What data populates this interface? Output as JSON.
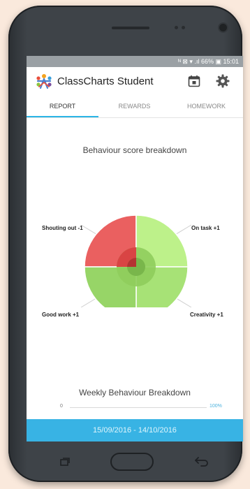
{
  "status_bar": {
    "text": "ᴺ ⊠ ▾ .ıl 66% ▣ 15:01"
  },
  "app": {
    "title": "ClassCharts Student"
  },
  "tabs": [
    {
      "label": "REPORT",
      "active": true
    },
    {
      "label": "REWARDS",
      "active": false
    },
    {
      "label": "HOMEWORK",
      "active": false
    }
  ],
  "report": {
    "breakdown_title": "Behaviour score breakdown",
    "weekly_title": "Weekly Behaviour Breakdown",
    "progress_min": "0",
    "progress_max": "100%",
    "date_range": "15/09/2016 - 14/10/2016"
  },
  "chart_data": {
    "type": "pie",
    "slices": [
      {
        "label": "Shouting out -1",
        "value": 1,
        "color": "#ea6060"
      },
      {
        "label": "On task +1",
        "value": 1,
        "color": "#bdf18a"
      },
      {
        "label": "Creativity +1",
        "value": 1,
        "color": "#a7e276"
      },
      {
        "label": "Good work +1",
        "value": 1,
        "color": "#97d567"
      }
    ]
  },
  "colors": {
    "accent": "#38b3e4",
    "negative": "#ea6060",
    "positive": "#97d567"
  }
}
